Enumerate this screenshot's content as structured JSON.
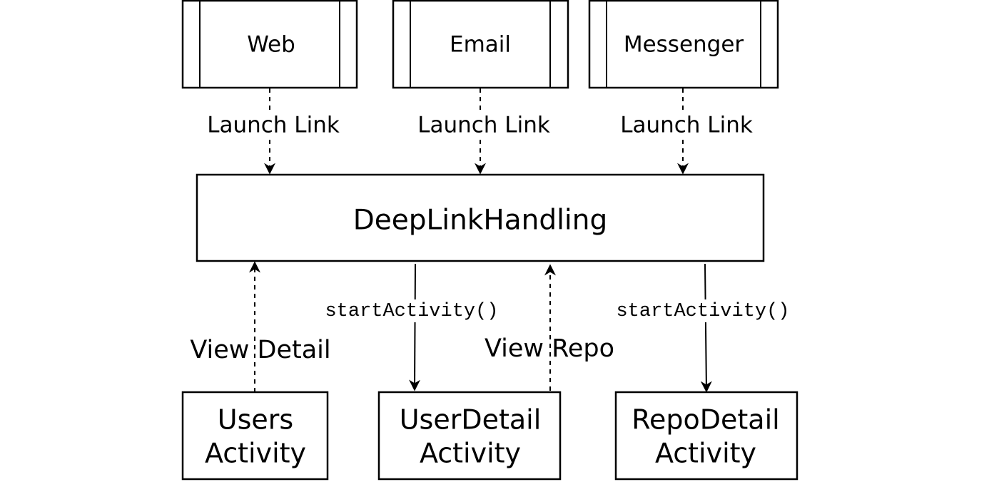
{
  "sources": [
    {
      "label": "Web"
    },
    {
      "label": "Email"
    },
    {
      "label": "Messenger"
    }
  ],
  "launch_label": "Launch Link",
  "handler": {
    "label": "DeepLinkHandling"
  },
  "edges": {
    "view_detail": "View Detail",
    "view_repo": "View Repo",
    "start_activity_1": "startActivity()",
    "start_activity_2": "startActivity()"
  },
  "activities": [
    {
      "line1": "Users",
      "line2": "Activity"
    },
    {
      "line1": "UserDetail",
      "line2": "Activity"
    },
    {
      "line1": "RepoDetail",
      "line2": "Activity"
    }
  ],
  "colors": {
    "stroke": "#000000",
    "background": "#ffffff"
  }
}
